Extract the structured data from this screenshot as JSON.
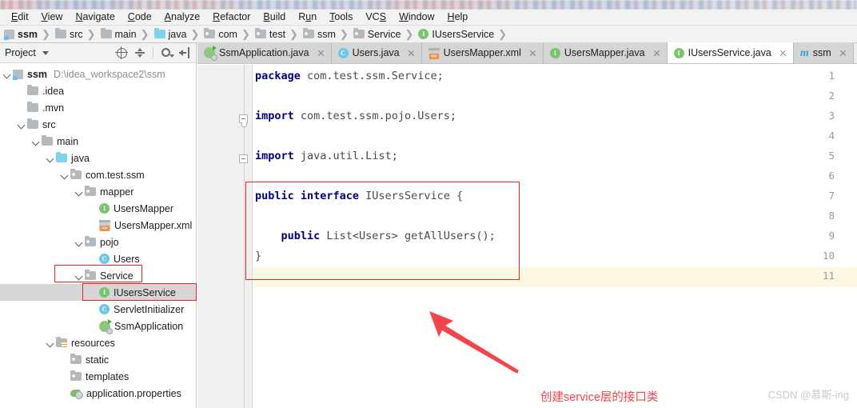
{
  "window": {
    "title_bar_blurred": true
  },
  "menubar": {
    "items": [
      {
        "label": "Edit",
        "mnemonic": "E"
      },
      {
        "label": "View",
        "mnemonic": "V"
      },
      {
        "label": "Navigate",
        "mnemonic": "N"
      },
      {
        "label": "Code",
        "mnemonic": "C"
      },
      {
        "label": "Analyze",
        "mnemonic": "A"
      },
      {
        "label": "Refactor",
        "mnemonic": "R"
      },
      {
        "label": "Build",
        "mnemonic": "B"
      },
      {
        "label": "Run",
        "mnemonic": "u"
      },
      {
        "label": "Tools",
        "mnemonic": "T"
      },
      {
        "label": "VCS",
        "mnemonic": "S"
      },
      {
        "label": "Window",
        "mnemonic": "W"
      },
      {
        "label": "Help",
        "mnemonic": "H"
      }
    ]
  },
  "breadcrumb": {
    "items": [
      {
        "label": "ssm",
        "icon": "module-icon",
        "bold": true
      },
      {
        "label": "src",
        "icon": "folder-icon"
      },
      {
        "label": "main",
        "icon": "folder-icon"
      },
      {
        "label": "java",
        "icon": "source-folder-icon"
      },
      {
        "label": "com",
        "icon": "package-icon"
      },
      {
        "label": "test",
        "icon": "package-icon"
      },
      {
        "label": "ssm",
        "icon": "package-icon"
      },
      {
        "label": "Service",
        "icon": "package-icon"
      },
      {
        "label": "IUsersService",
        "icon": "interface-icon"
      }
    ]
  },
  "project_panel": {
    "title": "Project",
    "toolbar": [
      "locate-icon",
      "collapse-all-icon",
      "settings-gear-icon",
      "hide-panel-icon"
    ],
    "tree": [
      {
        "label": "ssm",
        "path": "D:\\idea_workspace2\\ssm",
        "icon": "module-icon",
        "indent": 0,
        "arrow": "open",
        "bold": true
      },
      {
        "label": ".idea",
        "icon": "folder-icon",
        "indent": 1,
        "arrow": "none"
      },
      {
        "label": ".mvn",
        "icon": "folder-icon",
        "indent": 1,
        "arrow": "none"
      },
      {
        "label": "src",
        "icon": "folder-icon",
        "indent": 1,
        "arrow": "open"
      },
      {
        "label": "main",
        "icon": "folder-icon",
        "indent": 2,
        "arrow": "open"
      },
      {
        "label": "java",
        "icon": "source-folder-icon",
        "indent": 3,
        "arrow": "open"
      },
      {
        "label": "com.test.ssm",
        "icon": "package-icon",
        "indent": 4,
        "arrow": "open"
      },
      {
        "label": "mapper",
        "icon": "package-icon",
        "indent": 5,
        "arrow": "open"
      },
      {
        "label": "UsersMapper",
        "icon": "interface-icon",
        "indent": 6,
        "arrow": "none"
      },
      {
        "label": "UsersMapper.xml",
        "icon": "xml-file-icon",
        "indent": 6,
        "arrow": "none"
      },
      {
        "label": "pojo",
        "icon": "package-icon",
        "indent": 5,
        "arrow": "open"
      },
      {
        "label": "Users",
        "icon": "class-icon",
        "indent": 6,
        "arrow": "none"
      },
      {
        "label": "Service",
        "icon": "package-icon",
        "indent": 5,
        "arrow": "open"
      },
      {
        "label": "IUsersService",
        "icon": "interface-icon",
        "indent": 6,
        "arrow": "none",
        "selected": true
      },
      {
        "label": "ServletInitializer",
        "icon": "class-icon",
        "indent": 6,
        "arrow": "none"
      },
      {
        "label": "SsmApplication",
        "icon": "spring-boot-icon",
        "indent": 6,
        "arrow": "none"
      },
      {
        "label": "resources",
        "icon": "resources-folder-icon",
        "indent": 3,
        "arrow": "open"
      },
      {
        "label": "static",
        "icon": "package-icon",
        "indent": 4,
        "arrow": "none"
      },
      {
        "label": "templates",
        "icon": "package-icon",
        "indent": 4,
        "arrow": "none"
      },
      {
        "label": "application.properties",
        "icon": "properties-file-icon",
        "indent": 4,
        "arrow": "none"
      }
    ]
  },
  "editor": {
    "tabs": [
      {
        "label": "SsmApplication.java",
        "icon": "spring-boot-icon",
        "active": false
      },
      {
        "label": "Users.java",
        "icon": "class-icon",
        "active": false
      },
      {
        "label": "UsersMapper.xml",
        "icon": "xml-file-icon",
        "active": false
      },
      {
        "label": "UsersMapper.java",
        "icon": "interface-icon",
        "active": false
      },
      {
        "label": "IUsersService.java",
        "icon": "interface-icon",
        "active": true
      },
      {
        "label": "ssm",
        "icon": "maven-icon",
        "active": false
      }
    ],
    "line_numbers": [
      "1",
      "2",
      "3",
      "4",
      "5",
      "6",
      "7",
      "8",
      "9",
      "10",
      "11"
    ],
    "current_line": 11,
    "code": [
      {
        "n": 1,
        "kw": "package",
        "rest": " com.test.ssm.Service;"
      },
      {
        "n": 2,
        "kw": "",
        "rest": ""
      },
      {
        "n": 3,
        "kw": "import",
        "rest": " com.test.ssm.pojo.Users;",
        "fold": true
      },
      {
        "n": 4,
        "kw": "",
        "rest": ""
      },
      {
        "n": 5,
        "kw": "import",
        "rest": " java.util.List;",
        "fold": true
      },
      {
        "n": 6,
        "kw": "",
        "rest": ""
      },
      {
        "n": 7,
        "kw": "public interface",
        "rest": " IUsersService {"
      },
      {
        "n": 8,
        "kw": "",
        "rest": ""
      },
      {
        "n": 9,
        "kw": "    public",
        "rest": " List<Users> getAllUsers();"
      },
      {
        "n": 10,
        "kw": "",
        "rest": "}"
      },
      {
        "n": 11,
        "kw": "",
        "rest": ""
      }
    ]
  },
  "annotations": {
    "note_text": "创建service层的接口类",
    "note_color": "#f4434a",
    "box_color": "#ee2222",
    "boxes": [
      "tree-service-box",
      "tree-iusersservice-box",
      "code-interface-box"
    ],
    "arrow": "red-arrow-pointing-up-left"
  },
  "watermark": {
    "text": "CSDN @慕斯-ing"
  }
}
